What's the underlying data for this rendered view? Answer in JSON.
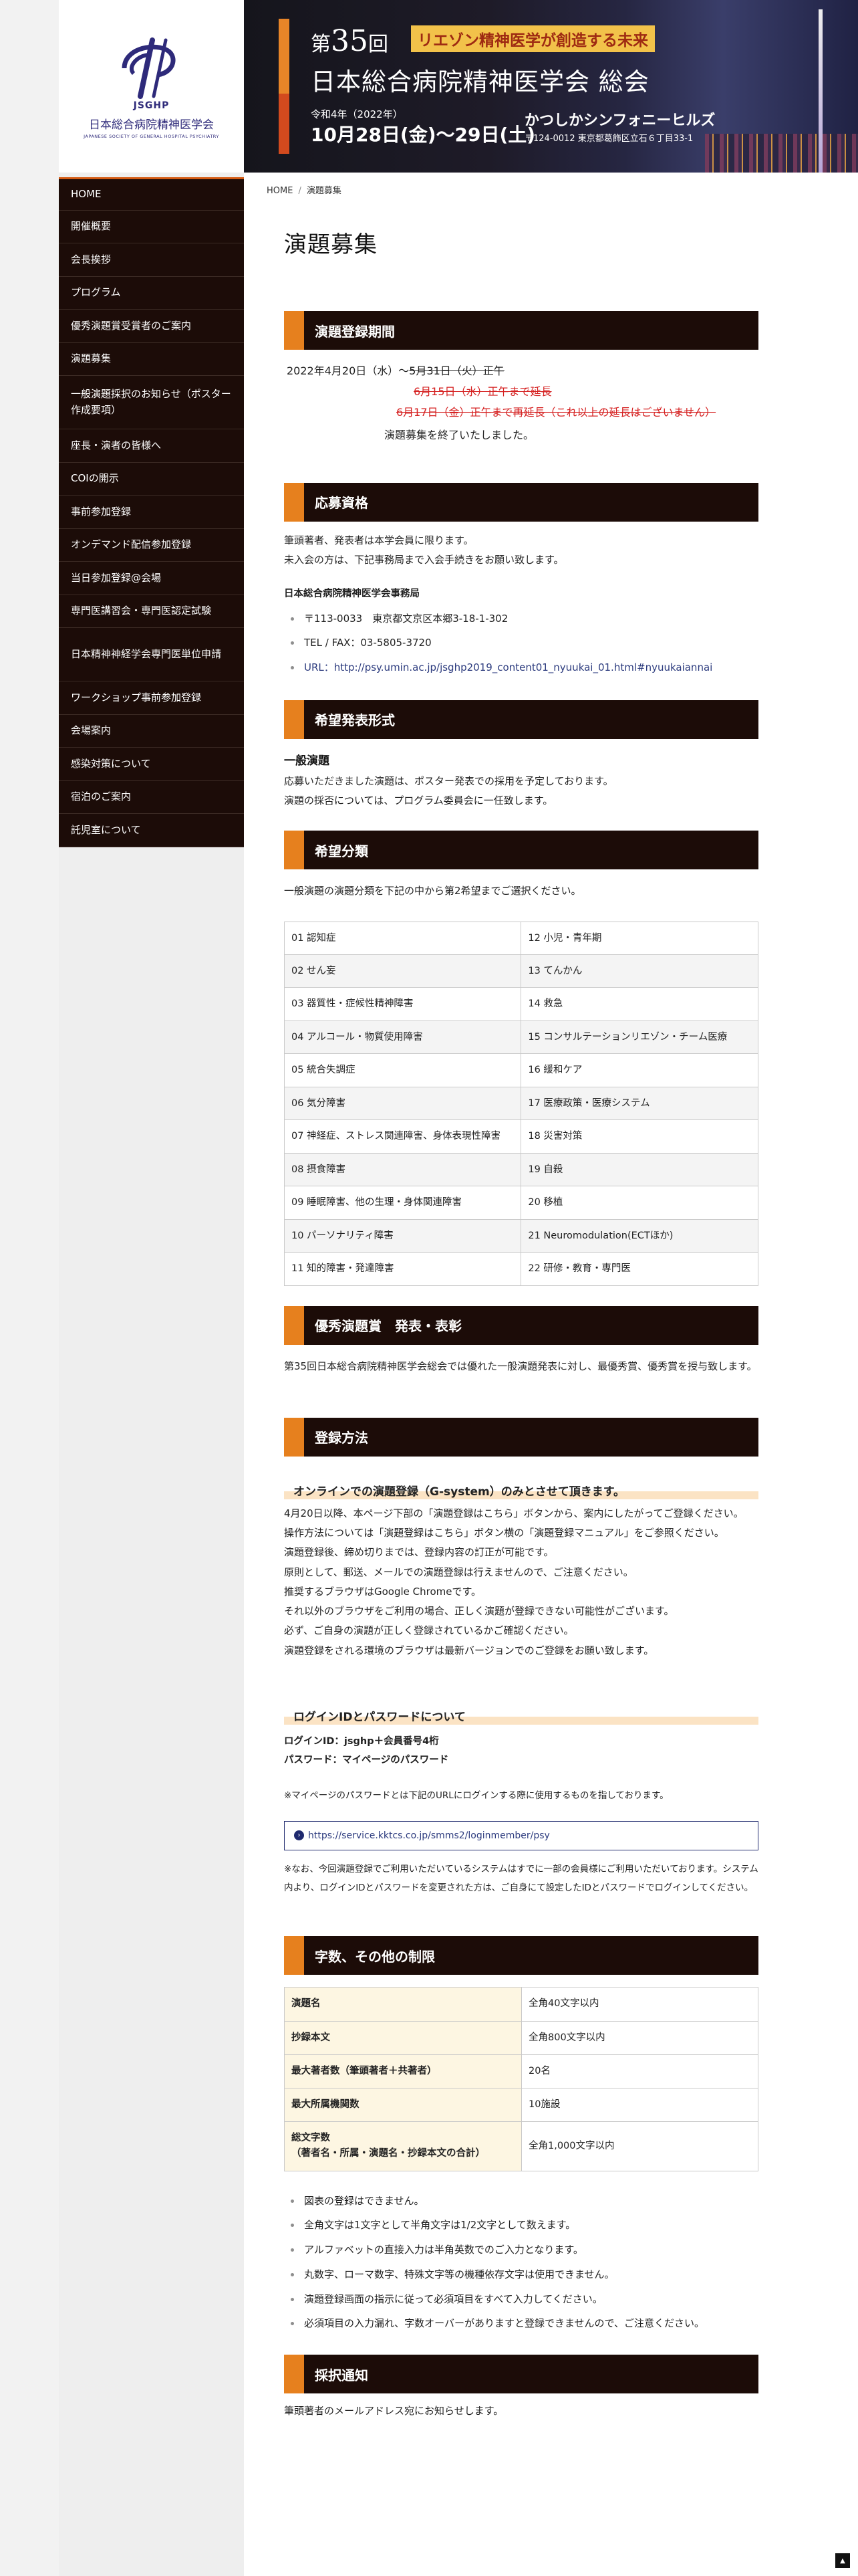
{
  "brand": {
    "logo_text": "JSGHP",
    "name_jp": "日本総合病院精神医学会",
    "name_en": "JAPANESE SOCIETY OF GENERAL HOSPITAL PSYCHIATRY"
  },
  "banner": {
    "dai": "第",
    "num": "35",
    "kai": "回",
    "tagline": "リエゾン精神医学が創造する未来",
    "title": "日本総合病院精神医学会 総会",
    "era": "令和4年（2022年）",
    "date": "10月28日(金)～29日(土)",
    "venue": "かつしかシンフォニーヒルズ",
    "address": "〒124-0012 東京都葛飾区立石６丁目33-1"
  },
  "nav": [
    "HOME",
    "開催概要",
    "会長挨拶",
    "プログラム",
    "優秀演題賞受賞者のご案内",
    "演題募集",
    "一般演題採択のお知らせ（ポスター作成要項）",
    "座長・演者の皆様へ",
    "COIの開示",
    "事前参加登録",
    "オンデマンド配信参加登録",
    "当日参加登録@会場",
    "専門医講習会・専門医認定試験",
    "日本精神神経学会専門医単位申請",
    "ワークショップ事前参加登録",
    "会場案内",
    "感染対策について",
    "宿泊のご案内",
    "託児室について"
  ],
  "breadcrumb": {
    "home": "HOME",
    "sep": "/",
    "current": "演題募集"
  },
  "page_title": "演題募集",
  "period": {
    "heading": "演題登録期間",
    "line1_prefix": "2022年4月20日（水）～",
    "line1_struck": "5月31日（火）正午",
    "line2_struck": "6月15日（水）正午まで延長",
    "line3_struck": "6月17日（金）正午まで再延長（これ以上の延長はございません）",
    "closed": "演題募集を終了いたしました。"
  },
  "eligibility": {
    "heading": "応募資格",
    "text1": "筆頭著者、発表者は本学会員に限ります。",
    "text2": "未入会の方は、下記事務局まで入会手続きをお願い致します。",
    "office": "日本総合病院精神医学会事務局",
    "address": "〒113-0033　東京都文京区本郷3-18-1-302",
    "tel": "TEL / FAX：03-5805-3720",
    "url_label": "URL：",
    "url": "http://psy.umin.ac.jp/jsghp2019_content01_nyuukai_01.html#nyuukaiannai"
  },
  "format": {
    "heading": "希望発表形式",
    "sub": "一般演題",
    "text1": "応募いただきました演題は、ポスター発表での採用を予定しております。",
    "text2": "演題の採否については、プログラム委員会に一任致します。"
  },
  "categories": {
    "heading": "希望分類",
    "intro": "一般演題の演題分類を下記の中から第2希望までご選択ください。",
    "rows": [
      [
        "01 認知症",
        "12 小児・青年期"
      ],
      [
        "02 せん妄",
        "13 てんかん"
      ],
      [
        "03 器質性・症候性精神障害",
        "14 救急"
      ],
      [
        "04 アルコール・物質使用障害",
        "15 コンサルテーションリエゾン・チーム医療"
      ],
      [
        "05 統合失調症",
        "16 緩和ケア"
      ],
      [
        "06 気分障害",
        "17 医療政策・医療システム"
      ],
      [
        "07 神経症、ストレス関連障害、身体表現性障害",
        "18 災害対策"
      ],
      [
        "08 摂食障害",
        "19 自殺"
      ],
      [
        "09 睡眠障害、他の生理・身体関連障害",
        "20 移植"
      ],
      [
        "10 パーソナリティ障害",
        "21 Neuromodulation(ECTほか)"
      ],
      [
        "11 知的障害・発達障害",
        "22 研修・教育・専門医"
      ]
    ]
  },
  "award": {
    "heading": "優秀演題賞　発表・表彰",
    "text": "第35回日本総合病院精神医学会総会では優れた一般演題発表に対し、最優秀賞、優秀賞を授与致します。"
  },
  "registration": {
    "heading": "登録方法",
    "online_head": "オンラインでの演題登録（G-system）のみとさせて頂きます。",
    "lines": [
      "4月20日以降、本ページ下部の「演題登録はこちら」ボタンから、案内にしたがってご登録ください。",
      "操作方法については「演題登録はこちら」ボタン横の「演題登録マニュアル」をご参照ください。",
      "演題登録後、締め切りまでは、登録内容の訂正が可能です。",
      "原則として、郵送、メールでの演題登録は行えませんので、ご注意ください。",
      "推奨するブラウザはGoogle Chromeです。",
      "それ以外のブラウザをご利用の場合、正しく演題が登録できない可能性がございます。",
      "必ず、ご自身の演題が正しく登録されているかご確認ください。",
      "演題登録をされる環境のブラウザは最新バージョンでのご登録をお願い致します。"
    ],
    "login_head": "ログインIDとパスワードについて",
    "login_id": "ログインID：jsghp＋会員番号4桁",
    "password": "パスワード：マイページのパスワード",
    "note1": "※マイページのパスワードとは下記のURLにログインする際に使用するものを指しております。",
    "member_url": "https://service.kktcs.co.jp/smms2/loginmember/psy",
    "note2": "※なお、今回演題登録でご利用いただいているシステムはすでに一部の会員様にご利用いただいております。システム内より、ログインIDとパスワードを変更された方は、ご自身にて設定したIDとパスワードでログインしてください。"
  },
  "limits": {
    "heading": "字数、その他の制限",
    "rows": [
      [
        "演題名",
        "全角40文字以内"
      ],
      [
        "抄録本文",
        "全角800文字以内"
      ],
      [
        "最大著者数（筆頭著者＋共著者）",
        "20名"
      ],
      [
        "最大所属機関数",
        "10施設"
      ],
      [
        "総文字数\n（著者名・所属・演題名・抄録本文の合計）",
        "全角1,000文字以内"
      ]
    ],
    "notes": [
      "図表の登録はできません。",
      "全角文字は1文字として半角文字は1/2文字として数えます。",
      "アルファベットの直接入力は半角英数でのご入力となります。",
      "丸数字、ローマ数字、特殊文字等の機種依存文字は使用できません。",
      "演題登録画面の指示に従って必須項目をすべて入力してください。",
      "必須項目の入力漏れ、字数オーバーがありますと登録できませんので、ご注意ください。"
    ]
  },
  "notification": {
    "heading": "採択通知",
    "text": "筆頭著者のメールアドレス宛にお知らせします。"
  },
  "to_top": "▲",
  "colors": {
    "dark": "#1c0c08",
    "accent": "#e6801e",
    "link": "#2c3b7e",
    "strike": "#d52020"
  }
}
